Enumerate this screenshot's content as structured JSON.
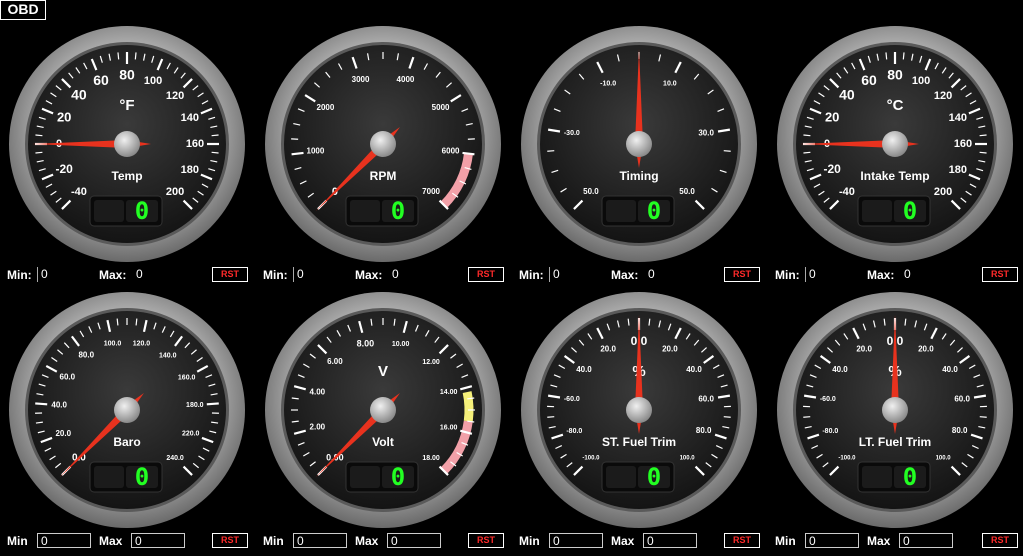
{
  "app": {
    "button_label": "OBD"
  },
  "stats_labels": {
    "min": "Min:",
    "max": "Max:",
    "min_plain": "Min",
    "max_plain": "Max",
    "reset": "RST"
  },
  "gauges": [
    {
      "id": "temp-f",
      "title": "Temp",
      "unit": "°F",
      "value_display": "0",
      "ticks": [
        "-40",
        "-20",
        "0",
        "20",
        "40",
        "60",
        "80",
        "100",
        "120",
        "140",
        "160",
        "180",
        "200"
      ],
      "tick_sizes": [
        11,
        12,
        11,
        13,
        14,
        14,
        14,
        11,
        11,
        11,
        11,
        11,
        11
      ],
      "range": [
        -40,
        200
      ],
      "needle": 0,
      "zone": null,
      "stats": {
        "min": "0",
        "max": "0"
      }
    },
    {
      "id": "rpm",
      "title": "RPM",
      "unit": "",
      "value_display": "0",
      "ticks": [
        "0",
        "1000",
        "2000",
        "3000",
        "4000",
        "5000",
        "6000",
        "7000"
      ],
      "tick_sizes": [
        11,
        8,
        8,
        8,
        8,
        8,
        8,
        8
      ],
      "range": [
        0,
        7000
      ],
      "needle": 0,
      "zone": {
        "from": 6000,
        "to": 7000,
        "color": "#f2a0a8"
      },
      "stats": {
        "min": "0",
        "max": "0"
      }
    },
    {
      "id": "timing",
      "title": "Timing",
      "unit": "",
      "value_display": "0",
      "ticks": [
        "50.0",
        "-30.0",
        "-10.0",
        "10.0",
        "30.0",
        "50.0"
      ],
      "tick_sizes": [
        8,
        7,
        7,
        7,
        8,
        8
      ],
      "range": [
        -50,
        50
      ],
      "needle": 0,
      "zone": null,
      "stats": {
        "min": "0",
        "max": "0"
      }
    },
    {
      "id": "intake-temp",
      "title": "Intake Temp",
      "unit": "°C",
      "value_display": "0",
      "ticks": [
        "-40",
        "-20",
        "0",
        "20",
        "40",
        "60",
        "80",
        "100",
        "120",
        "140",
        "160",
        "180",
        "200"
      ],
      "tick_sizes": [
        11,
        12,
        11,
        13,
        14,
        14,
        14,
        11,
        11,
        11,
        11,
        11,
        11
      ],
      "range": [
        -40,
        200
      ],
      "needle": 0,
      "zone": null,
      "stats": {
        "min": "0",
        "max": "0"
      }
    },
    {
      "id": "baro",
      "title": "Baro",
      "unit": "",
      "value_display": "0",
      "ticks": [
        "0.0",
        "20.0",
        "40.0",
        "60.0",
        "80.0",
        "100.0",
        "120.0",
        "140.0",
        "160.0",
        "180.0",
        "220.0",
        "240.0"
      ],
      "tick_sizes": [
        10,
        8,
        8,
        8,
        8,
        7,
        7,
        7,
        7,
        7,
        7,
        7
      ],
      "range": [
        0,
        240
      ],
      "needle": 0,
      "zone": null,
      "stats": {
        "min": "0",
        "max": "0"
      }
    },
    {
      "id": "volt",
      "title": "Volt",
      "unit": "V",
      "value_display": "0",
      "ticks": [
        "0.00",
        "2.00",
        "4.00",
        "6.00",
        "8.00",
        "10.00",
        "12.00",
        "14.00",
        "16.00",
        "18.00"
      ],
      "tick_sizes": [
        9,
        8,
        8,
        8,
        9,
        7,
        7,
        7,
        7,
        7
      ],
      "range": [
        0,
        18
      ],
      "needle": 0,
      "zone": {
        "from": 15.5,
        "to": 18,
        "color": "#f2a0a8"
      },
      "zone2": {
        "from": 14.2,
        "to": 15.5,
        "color": "#f5f07a"
      },
      "stats": {
        "min": "0",
        "max": "0"
      }
    },
    {
      "id": "st-fuel-trim",
      "title": "ST. Fuel Trim",
      "unit": "%",
      "value_display": "0",
      "ticks": [
        "-100.0",
        "-80.0",
        "-60.0",
        "40.0",
        "20.0",
        "0.0",
        "20.0",
        "40.0",
        "60.0",
        "80.0",
        "100.0"
      ],
      "tick_sizes": [
        6,
        7,
        7,
        8,
        8,
        12,
        8,
        8,
        8,
        8,
        6
      ],
      "range": [
        -100,
        100
      ],
      "needle": 0,
      "zone": null,
      "stats": {
        "min": "0",
        "max": "0"
      }
    },
    {
      "id": "lt-fuel-trim",
      "title": "LT. Fuel Trim",
      "unit": "%",
      "value_display": "0",
      "ticks": [
        "-100.0",
        "-80.0",
        "-60.0",
        "40.0",
        "20.0",
        "0.0",
        "20.0",
        "40.0",
        "60.0",
        "80.0",
        "100.0"
      ],
      "tick_sizes": [
        6,
        7,
        7,
        8,
        8,
        12,
        8,
        8,
        8,
        8,
        6
      ],
      "range": [
        -100,
        100
      ],
      "needle": 0,
      "zone": null,
      "stats": {
        "min": "0",
        "max": "0"
      }
    }
  ]
}
